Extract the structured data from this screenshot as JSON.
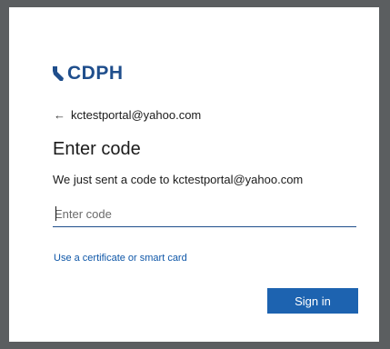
{
  "brand": {
    "logo_text": "CDPH",
    "logo_color": "#1f4e8c",
    "icon": "california-state-icon"
  },
  "back": {
    "arrow": "←",
    "email": "kctestportal@yahoo.com"
  },
  "title": "Enter code",
  "description": "We just sent a code to kctestportal@yahoo.com",
  "code_field": {
    "placeholder": "Enter code",
    "value": ""
  },
  "alt_option_link": "Use a certificate or smart card",
  "sign_in_button": "Sign in",
  "colors": {
    "accent": "#1d63b0",
    "link": "#0f57a8",
    "backdrop": "#5b5e60"
  }
}
